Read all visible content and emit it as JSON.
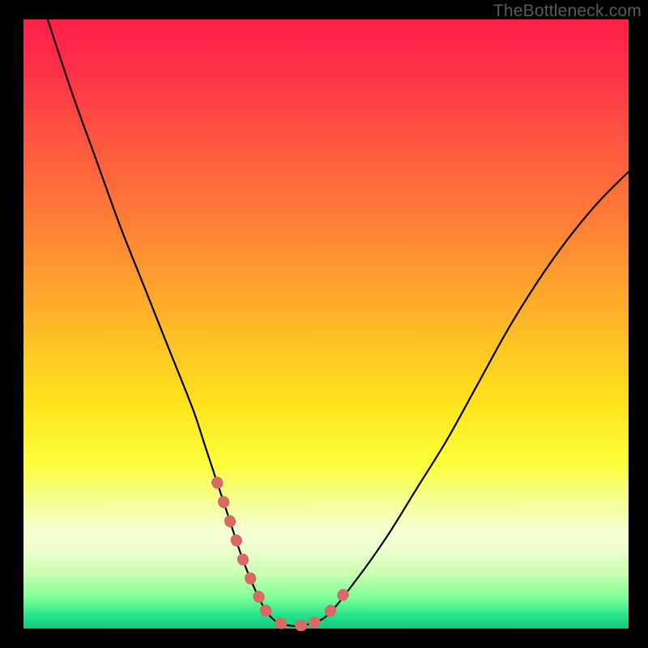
{
  "watermark": "TheBottleneck.com",
  "colors": {
    "frame": "#000000",
    "curve": "#000000",
    "highlight": "#d86a66"
  },
  "chart_data": {
    "type": "line",
    "title": "",
    "xlabel": "",
    "ylabel": "",
    "xlim": [
      0,
      100
    ],
    "ylim": [
      0,
      100
    ],
    "grid": false,
    "legend": false,
    "annotations": [],
    "series": [
      {
        "name": "curve",
        "x": [
          4,
          8,
          12,
          16,
          20,
          24,
          28,
          30,
          32,
          34,
          36,
          38,
          40,
          42,
          44,
          46,
          50,
          55,
          60,
          65,
          70,
          75,
          80,
          85,
          90,
          95,
          100
        ],
        "y": [
          100,
          88,
          77,
          66,
          56,
          46,
          36,
          30,
          24,
          18,
          12,
          7,
          3,
          1,
          0.5,
          0.5,
          2,
          8,
          15,
          23,
          31,
          40,
          49,
          57,
          64,
          70,
          75
        ]
      },
      {
        "name": "highlight-left",
        "x": [
          32,
          34,
          36,
          38,
          40
        ],
        "y": [
          24,
          18,
          12,
          7,
          3
        ]
      },
      {
        "name": "highlight-bottom",
        "x": [
          40,
          42,
          44,
          46,
          48
        ],
        "y": [
          3,
          1,
          0.5,
          0.5,
          1
        ]
      },
      {
        "name": "highlight-right",
        "x": [
          48,
          50,
          52,
          54
        ],
        "y": [
          1,
          2,
          4.5,
          7
        ]
      }
    ]
  }
}
